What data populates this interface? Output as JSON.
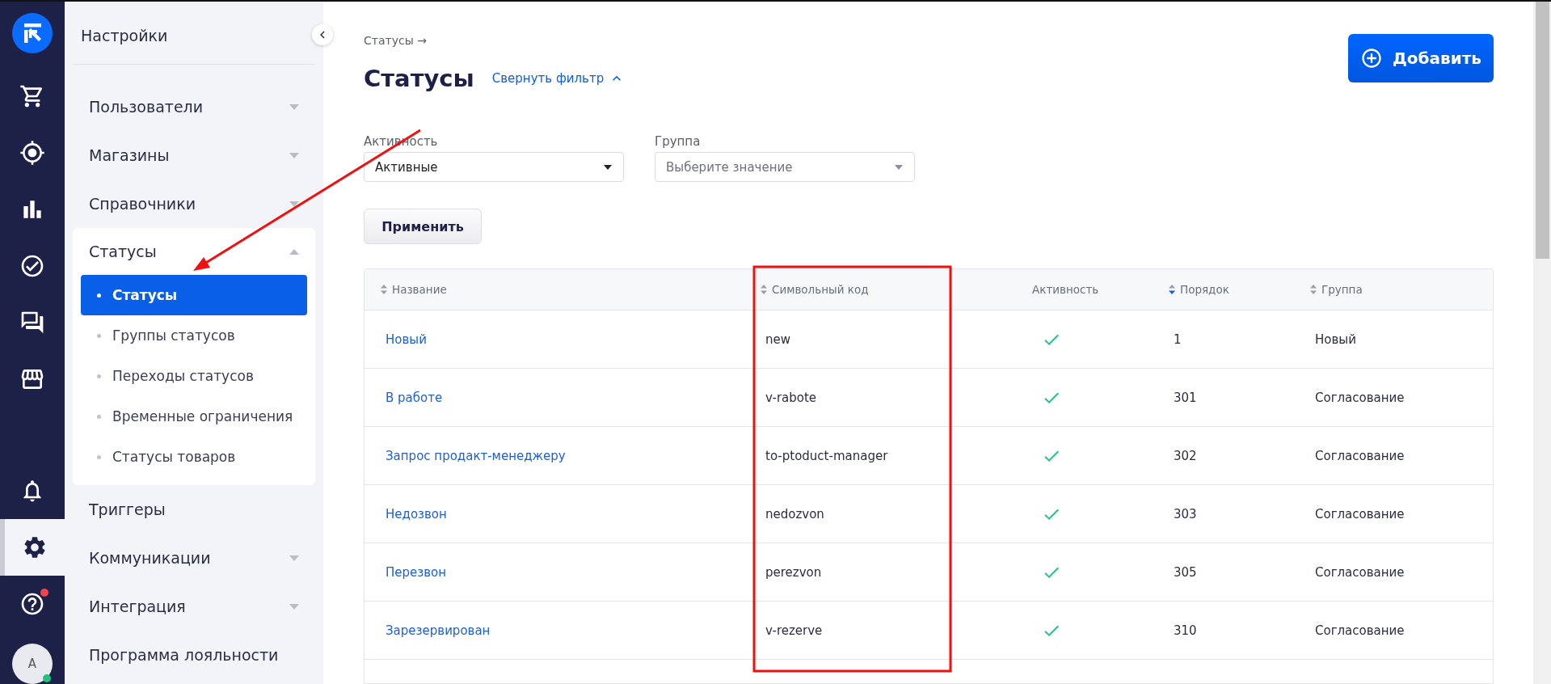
{
  "rail": {
    "items": [
      {
        "kind": "cart",
        "selected": false
      },
      {
        "kind": "target",
        "selected": false
      },
      {
        "kind": "chart",
        "selected": false
      },
      {
        "kind": "check",
        "selected": false
      },
      {
        "kind": "chat",
        "selected": false
      },
      {
        "kind": "store",
        "selected": false
      },
      {
        "kind": "bell",
        "selected": false
      },
      {
        "kind": "gear",
        "selected": true
      },
      {
        "kind": "help",
        "selected": false,
        "notification": true
      }
    ],
    "avatar": {
      "initial": "А",
      "online": true
    }
  },
  "sidebar": {
    "title": "Настройки",
    "items": [
      {
        "kind": "group",
        "label": "Пользователи",
        "expanded": false
      },
      {
        "kind": "group",
        "label": "Магазины",
        "expanded": false
      },
      {
        "kind": "group",
        "label": "Справочники",
        "expanded": false
      },
      {
        "kind": "group",
        "label": "Статусы",
        "expanded": true,
        "children": [
          {
            "label": "Статусы",
            "selected": true
          },
          {
            "label": "Группы статусов",
            "selected": false
          },
          {
            "label": "Переходы статусов",
            "selected": false
          },
          {
            "label": "Временные ограничения",
            "selected": false
          },
          {
            "label": "Статусы товаров",
            "selected": false
          }
        ]
      },
      {
        "kind": "link",
        "label": "Триггеры"
      },
      {
        "kind": "group",
        "label": "Коммуникации",
        "expanded": false
      },
      {
        "kind": "group",
        "label": "Интеграция",
        "expanded": false
      },
      {
        "kind": "link",
        "label": "Программа лояльности"
      }
    ]
  },
  "breadcrumb": "Статусы →",
  "title": "Статусы",
  "filter_toggle": {
    "label": "Свернуть фильтр",
    "expanded": true
  },
  "add_button": "Добавить",
  "filters": [
    {
      "label": "Активность",
      "value": "Активные"
    },
    {
      "label": "Группа",
      "placeholder": "Выберите значение"
    }
  ],
  "apply_button": "Применить",
  "table": {
    "columns": [
      {
        "label": "Название",
        "sortable": true,
        "sorted": false
      },
      {
        "label": "Символьный код",
        "sortable": true,
        "sorted": false
      },
      {
        "label": "Активность",
        "sortable": false
      },
      {
        "label": "Порядок",
        "sortable": true,
        "sorted": true
      },
      {
        "label": "Группа",
        "sortable": true,
        "sorted": false
      }
    ],
    "rows": [
      {
        "name": "Новый",
        "code": "new",
        "active": true,
        "order": "1",
        "group": "Новый"
      },
      {
        "name": "В работе",
        "code": "v-rabote",
        "active": true,
        "order": "301",
        "group": "Согласование"
      },
      {
        "name": "Запрос продакт-менеджеру",
        "code": "to-ptoduct-manager",
        "active": true,
        "order": "302",
        "group": "Согласование"
      },
      {
        "name": "Недозвон",
        "code": "nedozvon",
        "active": true,
        "order": "303",
        "group": "Согласование"
      },
      {
        "name": "Перезвон",
        "code": "perezvon",
        "active": true,
        "order": "305",
        "group": "Согласование"
      },
      {
        "name": "Зарезервирован",
        "code": "v-rezerve",
        "active": true,
        "order": "310",
        "group": "Согласование"
      }
    ]
  }
}
